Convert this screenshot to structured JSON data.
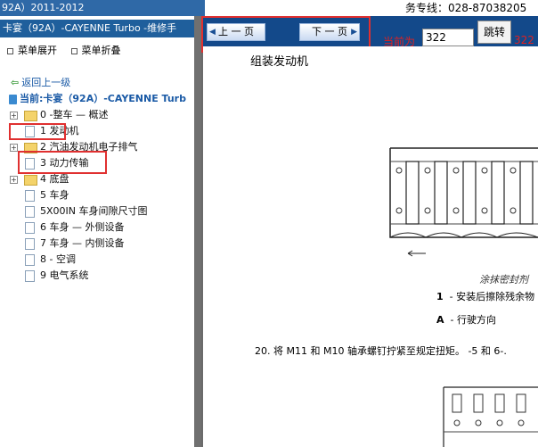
{
  "window": {
    "title_fragment": "92A）2011-2012"
  },
  "header": {
    "hotline": "务专线：028-87038205"
  },
  "left": {
    "title": "卡宴（92A）-CAYENNE Turbo -维修手",
    "menu": {
      "expand": "菜单展开",
      "collapse": "菜单折叠"
    },
    "back": "返回上一级",
    "current": "当前:卡宴（92A）-CAYENNE Turb",
    "tree": [
      {
        "label": "0 -整车 — 概述",
        "type": "folder",
        "expandable": true
      },
      {
        "label": "1 发动机",
        "type": "doc",
        "expandable": false,
        "highlight": true
      },
      {
        "label": "2 汽油发动机电子排气",
        "type": "folder",
        "expandable": true
      },
      {
        "label": "3 动力传输",
        "type": "doc",
        "expandable": false,
        "highlight": true
      },
      {
        "label": "4 底盘",
        "type": "folder",
        "expandable": true
      },
      {
        "label": "5 车身",
        "type": "doc",
        "expandable": false
      },
      {
        "label": "5X00IN 车身间隙尺寸图",
        "type": "doc",
        "expandable": false
      },
      {
        "label": "6 车身 — 外侧设备",
        "type": "doc",
        "expandable": false
      },
      {
        "label": "7 车身 — 内侧设备",
        "type": "doc",
        "expandable": false
      },
      {
        "label": "8 - 空调",
        "type": "doc",
        "expandable": false
      },
      {
        "label": "9 电气系统",
        "type": "doc",
        "expandable": false
      }
    ]
  },
  "toolbar": {
    "prev": "上 一 页",
    "next": "下 一 页",
    "current_label": "当前为",
    "page_value": "322",
    "jump": "跳转",
    "total": "322 /"
  },
  "doc": {
    "heading": "组装发动机",
    "caption": "涂抹密封剂",
    "legend": [
      {
        "key": "1",
        "text": "- 安装后擦除残余物"
      },
      {
        "key": "A",
        "text": "- 行驶方向"
      }
    ],
    "step": "20.   将 M11 和 M10 轴承螺钉拧紧至规定扭矩。 -5 和 6-."
  },
  "colors": {
    "toolbar": "#13498a",
    "highlight": "#e03030",
    "titlebar": "#1f5f9c"
  }
}
